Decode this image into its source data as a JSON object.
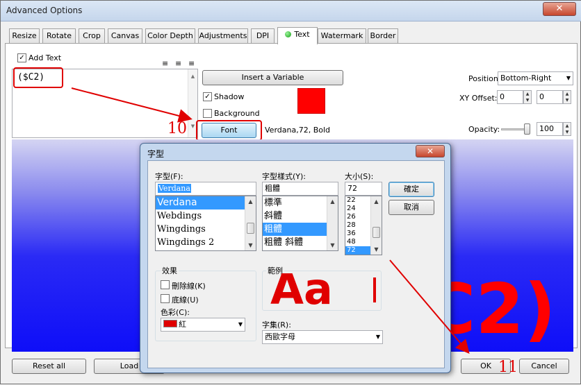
{
  "window": {
    "title": "Advanced Options",
    "close_glyph": "✕"
  },
  "tabs": [
    "Resize",
    "Rotate",
    "Crop",
    "Canvas",
    "Color Depth",
    "Adjustments",
    "DPI",
    "Text",
    "Watermark",
    "Border"
  ],
  "active_tab": "Text",
  "text_tab": {
    "add_text_label": "Add Text",
    "add_text_checked": true,
    "text_value": "($C2)",
    "insert_variable_label": "Insert a Variable",
    "shadow_label": "Shadow",
    "shadow_checked": true,
    "background_label": "Background",
    "background_checked": false,
    "font_button_label": "Font",
    "font_desc": "Verdana,72, Bold",
    "position_label": "Position:",
    "position_value": "Bottom-Right",
    "xy_offset_label": "XY Offset:",
    "x_offset": "0",
    "y_offset": "0",
    "opacity_label": "Opacity:",
    "opacity_value": "100",
    "color_swatch": "#ff0000"
  },
  "preview": {
    "text": "C2)",
    "text_color": "#ff0000"
  },
  "bottom_buttons": {
    "reset": "Reset all",
    "load": "Load",
    "ok": "OK",
    "cancel": "Cancel"
  },
  "annotations": {
    "step10": "10",
    "step11": "11",
    "color": "#e00000"
  },
  "font_dialog": {
    "title": "字型",
    "close_glyph": "✕",
    "font_label": "字型(F):",
    "font_value": "Verdana",
    "font_list": [
      "Verdana",
      "Webdings",
      "Wingdings",
      "Wingdings 2"
    ],
    "font_selected": "Verdana",
    "style_label": "字型樣式(Y):",
    "style_value": "粗體",
    "style_list": [
      "標準",
      "斜體",
      "粗體",
      "粗體 斜體"
    ],
    "style_selected": "粗體",
    "size_label": "大小(S):",
    "size_value": "72",
    "size_list": [
      "22",
      "24",
      "26",
      "28",
      "36",
      "48",
      "72"
    ],
    "size_selected": "72",
    "ok_label": "確定",
    "cancel_label": "取消",
    "effects_label": "效果",
    "strikeout_label": "刪除線(K)",
    "underline_label": "底線(U)",
    "color_label": "色彩(C):",
    "color_value": "紅",
    "color_hex": "#e00000",
    "sample_label": "範例",
    "sample_text": "Aa",
    "script_label": "字集(R):",
    "script_value": "西歐字母"
  }
}
